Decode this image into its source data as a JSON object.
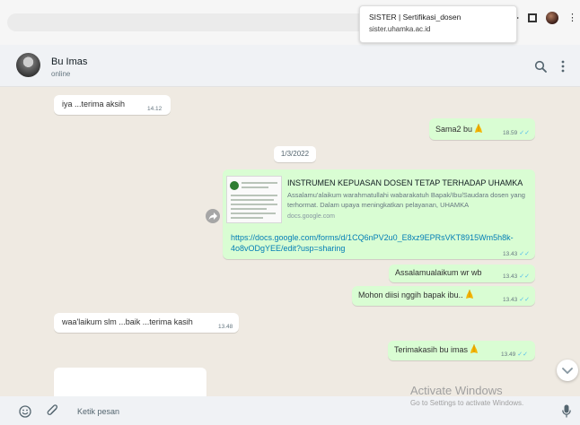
{
  "browser": {
    "tooltip_title": "SISTER | Sertifikasi_dosen",
    "tooltip_url": "sister.uhamka.ac.id"
  },
  "header": {
    "contact_name": "Bu Imas",
    "contact_status": "online"
  },
  "messages": [
    {
      "direction": "in",
      "text": "iya ...terima aksih",
      "time": "14.12"
    },
    {
      "direction": "out",
      "text": "Sama2 bu",
      "time": "18.59"
    },
    {
      "direction": "date",
      "text": "1/3/2022"
    },
    {
      "direction": "out",
      "type": "link",
      "card_title": "INSTRUMEN KEPUASAN DOSEN TETAP TERHADAP UHAMKA",
      "card_desc": "Assalamu'alaikum warahmatullahi wabarakatuh Bapak/Ibu/Saudara dosen yang terhormat. Dalam upaya meningkatkan pelayanan, UHAMKA",
      "card_domain": "docs.google.com",
      "url": "https://docs.google.com/forms/d/1CQ6nPV2u0_E8xz9EPRsVKT8915Wm5h8k-4o8vODgYEE/edit?usp=sharing",
      "time": "13.43"
    },
    {
      "direction": "out",
      "text": "Assalamualaikum wr wb",
      "time": "13.43"
    },
    {
      "direction": "out",
      "text": "Mohon diisi nggih bapak ibu..",
      "time": "13.43"
    },
    {
      "direction": "in",
      "text": "waa'laikum slm ...baik ...terima kasih",
      "time": "13.48"
    },
    {
      "direction": "out",
      "text": "Terimakasih bu imas",
      "time": "13.49"
    }
  ],
  "composer": {
    "placeholder": "Ketik pesan"
  },
  "watermark": {
    "line1": "Activate Windows",
    "line2": "Go to Settings to activate Windows."
  },
  "colors": {
    "incoming_bubble": "#ffffff",
    "outgoing_bubble": "#d9fdd3",
    "chat_background": "#efeae2",
    "link_color": "#027eb5",
    "read_ticks": "#53bdeb"
  }
}
